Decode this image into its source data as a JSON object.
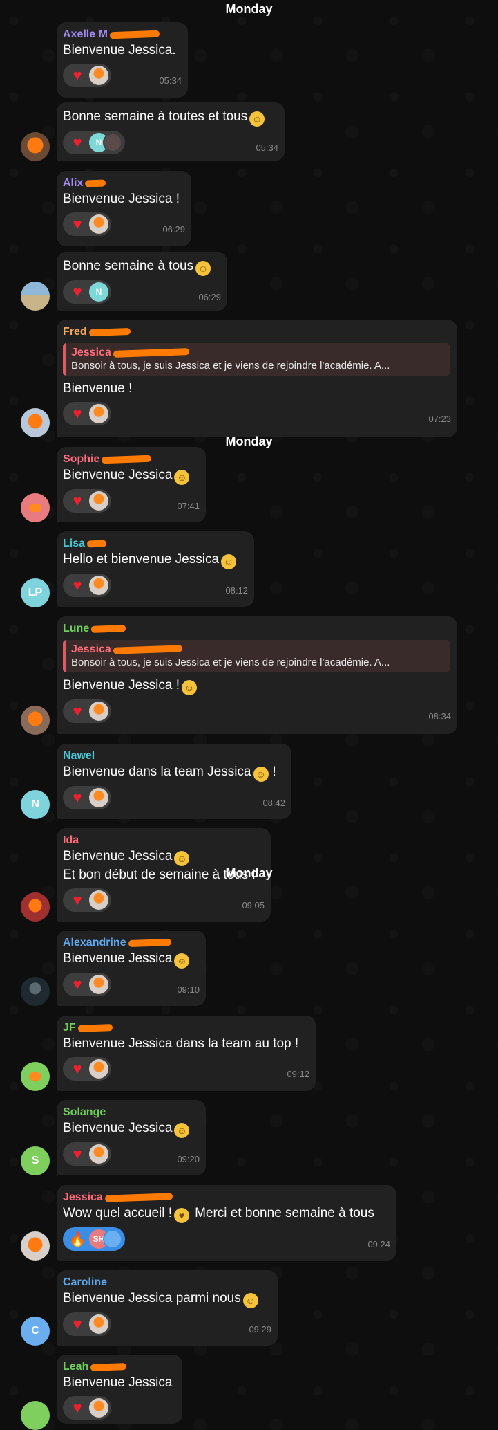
{
  "day_labels": [
    "Monday",
    "Monday",
    "Monday"
  ],
  "colors": {
    "background": "#0e0e0e",
    "bubble": "#212121",
    "reaction": "#3d3d3d",
    "heart": "#f0202e",
    "name_purple": "#a58cf5",
    "name_orange": "#f4a55c",
    "name_pink": "#ff6b7d",
    "name_teal": "#45c7d6",
    "name_green": "#6fcf5b",
    "name_blue": "#5fa8f0",
    "name_red": "#ff6b78"
  },
  "messages": [
    {
      "sender": "Axelle M",
      "text": [
        "Bienvenue Jessica."
      ],
      "time": "05:34"
    },
    {
      "sender": "",
      "text": [
        "Bonne semaine à toutes et tous"
      ],
      "time": "05:34",
      "reaction_initial": "N"
    },
    {
      "sender": "Alix",
      "text": [
        "Bienvenue Jessica !"
      ],
      "time": "06:29"
    },
    {
      "sender": "",
      "text": [
        "Bonne semaine à tous"
      ],
      "time": "06:29",
      "reaction_initial": "N"
    },
    {
      "sender": "Fred",
      "reply": {
        "name": "Jessica",
        "text": "Bonsoir à tous, je suis Jessica et je viens de rejoindre l'académie. A..."
      },
      "text": [
        "Bienvenue !"
      ],
      "time": "07:23"
    },
    {
      "sender": "Sophie",
      "text": [
        "Bienvenue Jessica"
      ],
      "time": "07:41"
    },
    {
      "sender": "Lisa",
      "text": [
        "Hello et bienvenue Jessica"
      ],
      "time": "08:12",
      "avatar_initials": "LP"
    },
    {
      "sender": "Lune",
      "reply": {
        "name": "Jessica",
        "text": "Bonsoir à tous, je suis Jessica et je viens de rejoindre l'académie. A..."
      },
      "text": [
        "Bienvenue Jessica !"
      ],
      "time": "08:34"
    },
    {
      "sender": "Nawel",
      "text": [
        "Bienvenue dans la team Jessica",
        "!"
      ],
      "time": "08:42",
      "avatar_initials": "N"
    },
    {
      "sender": "Ida",
      "text": [
        "Bienvenue Jessica",
        "Et bon début de semaine à tous !"
      ],
      "time": "09:05"
    },
    {
      "sender": "Alexandrine",
      "text": [
        "Bienvenue Jessica"
      ],
      "time": "09:10"
    },
    {
      "sender": "JF",
      "text": [
        "Bienvenue Jessica dans la team au top !"
      ],
      "time": "09:12"
    },
    {
      "sender": "Solange",
      "text": [
        "Bienvenue Jessica"
      ],
      "time": "09:20",
      "avatar_initials": "S"
    },
    {
      "sender": "Jessica",
      "text": [
        "Wow quel accueil !",
        "Merci et bonne semaine à tous"
      ],
      "time": "09:24",
      "reaction_initial": "SH"
    },
    {
      "sender": "Caroline",
      "text": [
        "Bienvenue Jessica parmi nous"
      ],
      "time": "09:29",
      "avatar_initials": "C"
    },
    {
      "sender": "Leah",
      "text": [
        "Bienvenue Jessica"
      ],
      "time": ""
    }
  ]
}
